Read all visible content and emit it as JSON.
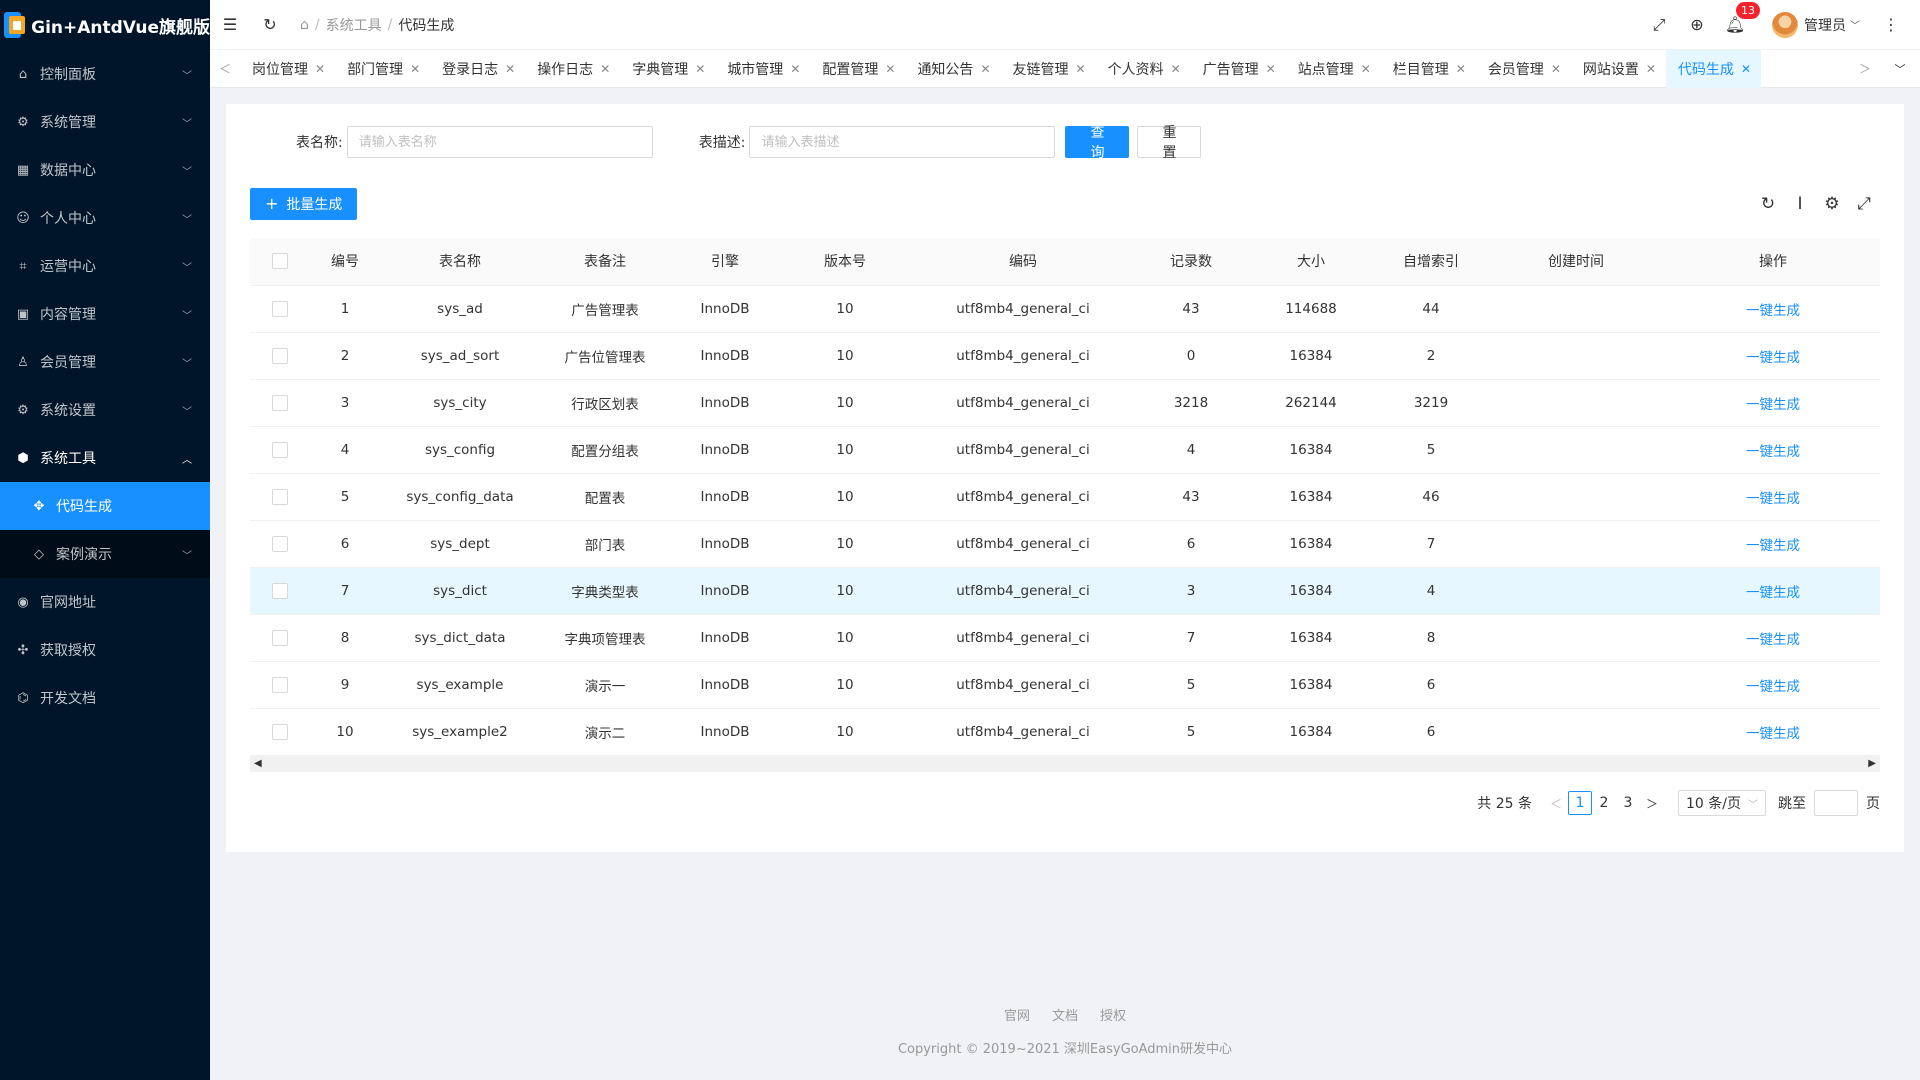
{
  "app": {
    "title": "Gin+AntdVue旗舰版"
  },
  "sidebar": {
    "items": [
      {
        "label": "控制面板",
        "icon": "dashboard-icon"
      },
      {
        "label": "系统管理",
        "icon": "settings-icon"
      },
      {
        "label": "数据中心",
        "icon": "grid-icon"
      },
      {
        "label": "个人中心",
        "icon": "user-icon"
      },
      {
        "label": "运营中心",
        "icon": "operations-icon"
      },
      {
        "label": "内容管理",
        "icon": "content-icon"
      },
      {
        "label": "会员管理",
        "icon": "member-icon"
      },
      {
        "label": "系统设置",
        "icon": "settings-icon"
      },
      {
        "label": "系统工具",
        "icon": "tool-icon"
      },
      {
        "label": "代码生成",
        "icon": "code-icon"
      },
      {
        "label": "案例演示",
        "icon": "demo-icon"
      },
      {
        "label": "官网地址",
        "icon": "globe-icon"
      },
      {
        "label": "获取授权",
        "icon": "auth-icon"
      },
      {
        "label": "开发文档",
        "icon": "doc-icon"
      }
    ]
  },
  "header": {
    "breadcrumb": [
      "系统工具",
      "代码生成"
    ],
    "notification_count": "13",
    "user_name": "管理员"
  },
  "tabs": [
    "岗位管理",
    "部门管理",
    "登录日志",
    "操作日志",
    "字典管理",
    "城市管理",
    "配置管理",
    "通知公告",
    "友链管理",
    "个人资料",
    "广告管理",
    "站点管理",
    "栏目管理",
    "会员管理",
    "网站设置",
    "代码生成"
  ],
  "search": {
    "name_label": "表名称:",
    "name_placeholder": "请输入表名称",
    "desc_label": "表描述:",
    "desc_placeholder": "请输入表描述",
    "query_label": "查 询",
    "reset_label": "重 置"
  },
  "toolbar": {
    "batch_label": "批量生成"
  },
  "table": {
    "columns": [
      "编号",
      "表名称",
      "表备注",
      "引擎",
      "版本号",
      "编码",
      "记录数",
      "大小",
      "自增索引",
      "创建时间",
      "操作"
    ],
    "action_label": "一键生成",
    "rows": [
      [
        "1",
        "sys_ad",
        "广告管理表",
        "InnoDB",
        "10",
        "utf8mb4_general_ci",
        "43",
        "114688",
        "44",
        ""
      ],
      [
        "2",
        "sys_ad_sort",
        "广告位管理表",
        "InnoDB",
        "10",
        "utf8mb4_general_ci",
        "0",
        "16384",
        "2",
        ""
      ],
      [
        "3",
        "sys_city",
        "行政区划表",
        "InnoDB",
        "10",
        "utf8mb4_general_ci",
        "3218",
        "262144",
        "3219",
        ""
      ],
      [
        "4",
        "sys_config",
        "配置分组表",
        "InnoDB",
        "10",
        "utf8mb4_general_ci",
        "4",
        "16384",
        "5",
        ""
      ],
      [
        "5",
        "sys_config_data",
        "配置表",
        "InnoDB",
        "10",
        "utf8mb4_general_ci",
        "43",
        "16384",
        "46",
        ""
      ],
      [
        "6",
        "sys_dept",
        "部门表",
        "InnoDB",
        "10",
        "utf8mb4_general_ci",
        "6",
        "16384",
        "7",
        ""
      ],
      [
        "7",
        "sys_dict",
        "字典类型表",
        "InnoDB",
        "10",
        "utf8mb4_general_ci",
        "3",
        "16384",
        "4",
        ""
      ],
      [
        "8",
        "sys_dict_data",
        "字典项管理表",
        "InnoDB",
        "10",
        "utf8mb4_general_ci",
        "7",
        "16384",
        "8",
        ""
      ],
      [
        "9",
        "sys_example",
        "演示一",
        "InnoDB",
        "10",
        "utf8mb4_general_ci",
        "5",
        "16384",
        "6",
        ""
      ],
      [
        "10",
        "sys_example2",
        "演示二",
        "InnoDB",
        "10",
        "utf8mb4_general_ci",
        "5",
        "16384",
        "6",
        ""
      ]
    ]
  },
  "pagination": {
    "total": "共 25 条",
    "pages": [
      "1",
      "2",
      "3"
    ],
    "page_size": "10 条/页",
    "jump_label": "跳至",
    "page_unit": "页"
  },
  "footer": {
    "links": [
      "官网",
      "文档",
      "授权"
    ],
    "copyright": "Copyright © 2019~2021 深圳EasyGoAdmin研发中心"
  },
  "colors": {
    "primary": "#1890ff",
    "sidebar_bg": "#001529",
    "badge": "#f5222d"
  }
}
